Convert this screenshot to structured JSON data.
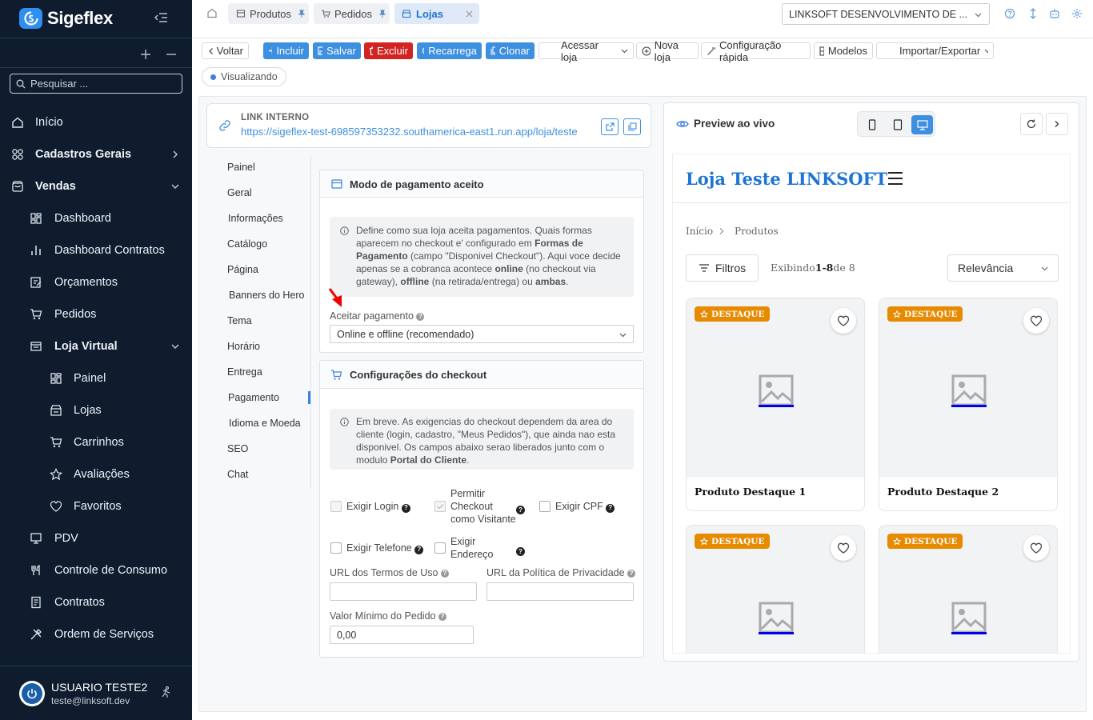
{
  "app": {
    "name": "Sigeflex"
  },
  "sidebar": {
    "search_placeholder": "Pesquisar ...",
    "items": [
      {
        "label": "Início",
        "icon": "home-icon"
      },
      {
        "label": "Cadastros Gerais",
        "icon": "grid-icon"
      },
      {
        "label": "Vendas",
        "icon": "bag-icon"
      },
      {
        "label": "Dashboard",
        "icon": "dashboard-icon"
      },
      {
        "label": "Dashboard Contratos",
        "icon": "bar-chart-icon"
      },
      {
        "label": "Orçamentos",
        "icon": "edit-doc-icon"
      },
      {
        "label": "Pedidos",
        "icon": "cart-icon"
      },
      {
        "label": "Loja Virtual",
        "icon": "store-icon"
      },
      {
        "label": "Painel",
        "icon": "dashboard-icon"
      },
      {
        "label": "Lojas",
        "icon": "shop-icon"
      },
      {
        "label": "Carrinhos",
        "icon": "cart-icon"
      },
      {
        "label": "Avaliações",
        "icon": "star-icon"
      },
      {
        "label": "Favoritos",
        "icon": "heart-icon"
      },
      {
        "label": "PDV",
        "icon": "monitor-icon"
      },
      {
        "label": "Controle de Consumo",
        "icon": "utensils-icon"
      },
      {
        "label": "Contratos",
        "icon": "document-icon"
      },
      {
        "label": "Ordem de Serviços",
        "icon": "tools-icon"
      }
    ],
    "user": {
      "name": "USUARIO TESTE2",
      "email": "teste@linksoft.dev"
    }
  },
  "tabs": [
    {
      "label": "Produtos",
      "pinned": true
    },
    {
      "label": "Pedidos",
      "pinned": true
    },
    {
      "label": "Lojas",
      "active": true
    }
  ],
  "company_select": "LINKSOFT DESENVOLVIMENTO DE ...",
  "toolbar": {
    "back": "Voltar",
    "include": "Incluir",
    "save": "Salvar",
    "delete": "Excluir",
    "reload": "Recarrega",
    "clone": "Clonar",
    "access_store": "Acessar loja",
    "new_store": "Nova loja",
    "quick_config": "Configuração rápida",
    "models": "Modelos",
    "import_export": "Importar/Exportar"
  },
  "status": "Visualizando",
  "link": {
    "title": "LINK INTERNO",
    "url": "https://sigeflex-test-698597353232.southamerica-east1.run.app/loja/teste"
  },
  "config_menu": [
    "Painel",
    "Geral",
    "Informações",
    "Catálogo",
    "Página",
    "Banners do Hero",
    "Tema",
    "Horário",
    "Entrega",
    "Pagamento",
    "Idioma e Moeda",
    "SEO",
    "Chat"
  ],
  "config_menu_active": "Pagamento",
  "payment": {
    "title": "Modo de pagamento aceito",
    "info": {
      "p1": "Define como sua loja aceita pagamentos. Quais formas aparecem no checkout e' configurado em ",
      "b1": "Formas de Pagamento",
      "p2": " (campo \"Disponivel Checkout\"). Aqui voce decide apenas se a cobranca acontece ",
      "b2": "online",
      "p3": " (no checkout via gateway), ",
      "b3": "offline",
      "p4": " (na retirada/entrega) ou ",
      "b4": "ambas",
      "p5": "."
    },
    "accept_label": "Aceitar pagamento",
    "accept_value": "Online e offline (recomendado)"
  },
  "checkout": {
    "title": "Configurações do checkout",
    "info": {
      "p1": "Em breve. As exigencias do checkout dependem da area do cliente (login, cadastro, \"Meus Pedidos\"), que ainda nao esta disponivel. Os campos abaixo serao liberados junto com o modulo ",
      "b1": "Portal do Cliente",
      "p2": "."
    },
    "require_login": "Exigir Login",
    "allow_guest": "Permitir Checkout como Visitante",
    "require_cpf": "Exigir CPF",
    "require_phone": "Exigir Telefone",
    "require_address": "Exigir Endereço",
    "terms_label": "URL dos Termos de Uso",
    "terms_value": "",
    "privacy_label": "URL da Política de Privacidade",
    "privacy_value": "",
    "min_order_label": "Valor Mínimo do Pedido",
    "min_order_value": "0,00"
  },
  "preview": {
    "title": "Preview ao vivo",
    "store_name": "Loja Teste LINKSOFT",
    "breadcrumb_home": "Início",
    "breadcrumb_current": "Produtos",
    "filters": "Filtros",
    "showing_prefix": "Exibindo",
    "showing_range": "1-8",
    "showing_suffix": "de 8",
    "sort": "Relevância",
    "badge": "DESTAQUE",
    "products": [
      {
        "name": "Produto Destaque 1"
      },
      {
        "name": "Produto Destaque 2"
      },
      {
        "name": ""
      },
      {
        "name": ""
      }
    ]
  },
  "colors": {
    "sidebar_bg": "#0f1c2e",
    "accent": "#3d8fe0",
    "danger": "#d32424",
    "badge": "#e68a00",
    "brand_blue": "#1e74d6"
  }
}
